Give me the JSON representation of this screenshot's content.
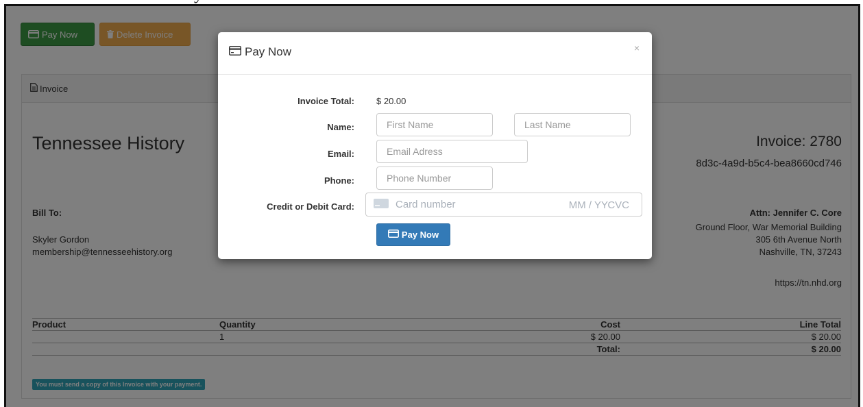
{
  "caption": "y",
  "toolbar": {
    "pay_now_label": "Pay Now",
    "delete_invoice_label": "Delete Invoice"
  },
  "panel": {
    "heading": "Invoice"
  },
  "invoice": {
    "org_name": "Tennessee History",
    "number_label": "Invoice: 2780",
    "guid_fragment": "8d3c-4a9d-b5c4-bea8660cd746"
  },
  "bill_to": {
    "label": "Bill To:",
    "name": "Skyler Gordon",
    "email": "membership@tennesseehistory.org"
  },
  "remit": {
    "attn": "Attn: Jennifer C. Core",
    "address_lines": [
      "Ground Floor, War Memorial Building",
      "305 6th Avenue North",
      "Nashville, TN, 37243"
    ],
    "website": "https://tn.nhd.org"
  },
  "table": {
    "headers": [
      "Product",
      "Quantity",
      "Cost",
      "Line Total"
    ],
    "rows": [
      {
        "product": "",
        "quantity": "1",
        "cost": "$ 20.00",
        "line_total": "$ 20.00"
      }
    ],
    "total_label": "Total:",
    "total_value": "$ 20.00"
  },
  "notice": "You must send a copy of this Invoice with your payment.",
  "modal": {
    "title": "Pay Now",
    "close": "×",
    "invoice_total_label": "Invoice Total:",
    "invoice_total_value": "$ 20.00",
    "name_label": "Name:",
    "first_name_placeholder": "First Name",
    "last_name_placeholder": "Last Name",
    "email_label": "Email:",
    "email_placeholder": "Email Adress",
    "phone_label": "Phone:",
    "phone_placeholder": "Phone Number",
    "card_label": "Credit or Debit Card:",
    "card_number_placeholder": "Card number",
    "card_exp_placeholder": "MM / YY",
    "card_cvc_placeholder": "CVC",
    "pay_button_label": "Pay Now"
  },
  "colors": {
    "green_button": "#3c9a45",
    "orange_button": "#f0ad4e",
    "primary_button": "#337ab7",
    "notice_bg": "#31a4b8"
  },
  "icons": {
    "pay_now": "credit-card-icon",
    "delete": "trash-icon",
    "invoice": "file-text-icon",
    "card_brand": "card-placeholder-icon"
  }
}
